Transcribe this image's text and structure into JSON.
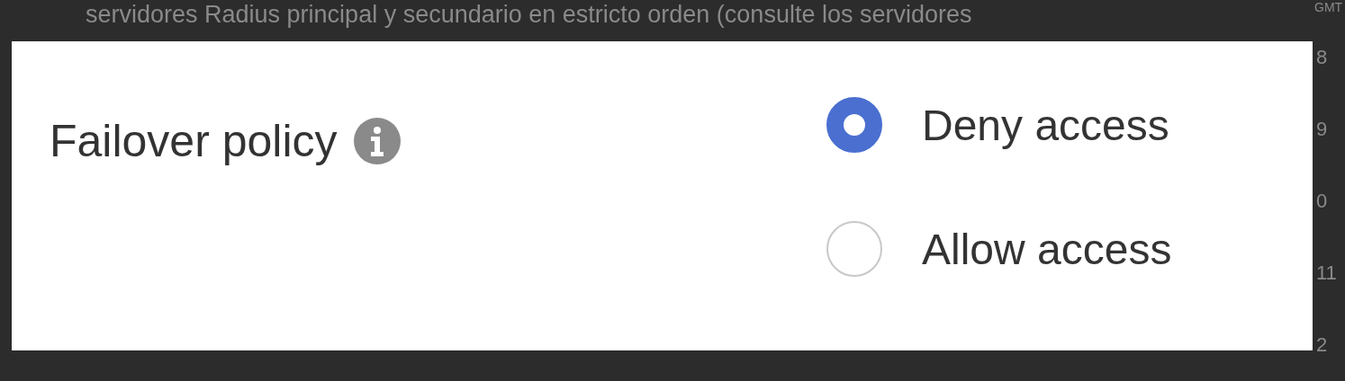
{
  "background": {
    "text": "servidores Radius principal y secundario en estricto orden (consulte los servidores",
    "column_header": "GMT",
    "column_cells": [
      "8",
      "9",
      "0",
      "11",
      "2"
    ]
  },
  "dialog": {
    "label": "Failover policy",
    "options": [
      {
        "label": "Deny access",
        "selected": true
      },
      {
        "label": "Allow access",
        "selected": false
      }
    ]
  }
}
